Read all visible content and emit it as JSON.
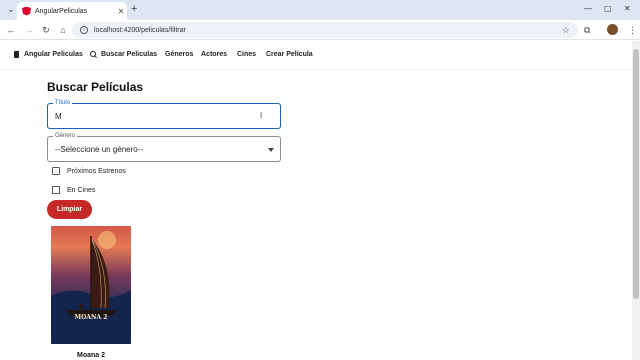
{
  "browser": {
    "tab_title": "AngularPeliculas",
    "url": "localhost:4200/peliculas/filtrar"
  },
  "nav": {
    "brand": "Angular Peliculas",
    "items": [
      "Buscar Peliculas",
      "Géneros",
      "Actores",
      "Cines",
      "Crear Película"
    ]
  },
  "page": {
    "title": "Buscar Películas"
  },
  "form": {
    "titulo_label": "Título",
    "titulo_value": "M",
    "genero_label": "Género",
    "genero_value": "--Seleccione un género--",
    "checkboxes": [
      {
        "label": "Próximos Estrenos",
        "checked": false
      },
      {
        "label": "En Cines",
        "checked": false
      }
    ],
    "clear_label": "Limpiar"
  },
  "results": [
    {
      "title": "Moana 2",
      "poster_text": "MOANA 2"
    }
  ],
  "colors": {
    "accent": "#1565c0",
    "button": "#c62828"
  }
}
